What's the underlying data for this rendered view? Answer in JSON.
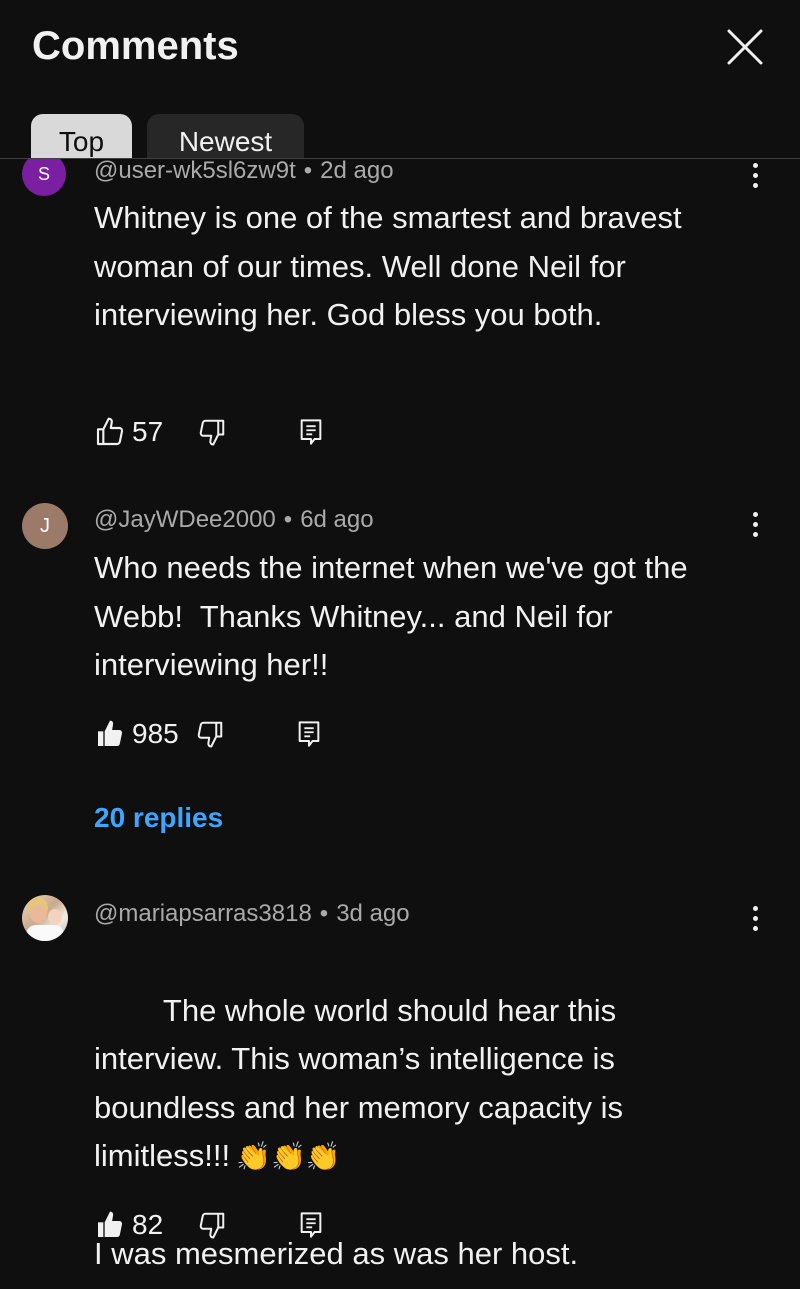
{
  "header": {
    "title": "Comments",
    "tabs": [
      {
        "label": "Top",
        "selected": true
      },
      {
        "label": "Newest",
        "selected": false
      }
    ]
  },
  "comments": [
    {
      "avatar_letter": "S",
      "avatar_color": "#7b1fa2",
      "author": "@user-wk5sl6zw9t",
      "time": "2d ago",
      "text": "Whitney is one of the smartest and bravest woman of our times. Well done Neil for interviewing her. God bless you both.",
      "likes": "57",
      "liked": false
    },
    {
      "avatar_letter": "J",
      "avatar_color": "#9c7a6a",
      "author": "@JayWDee2000",
      "time": "6d ago",
      "text": "Who needs the internet when we've got the Webb!  Thanks Whitney... and Neil for interviewing her!!",
      "likes": "985",
      "liked": true,
      "replies": "20 replies"
    },
    {
      "avatar_letter": "",
      "avatar_color": "#c9a98c",
      "author": "@mariapsarras3818",
      "time": "3d ago",
      "text_line1": "The whole world should hear this interview. This woman’s intelligence is boundless and her memory capacity is limitless!!!",
      "emoji": "👏👏👏",
      "text_line2": "I was mesmerized as was her host.",
      "likes": "82",
      "liked": true
    }
  ],
  "icons": {
    "close": "close-icon",
    "more": "more-vert-icon",
    "like": "thumb-up-icon",
    "dislike": "thumb-down-icon",
    "reply": "reply-icon"
  },
  "colors": {
    "background": "#0f0f0f",
    "text": "#f1f1f1",
    "meta": "#aaaaaa",
    "link": "#3ea6ff"
  }
}
